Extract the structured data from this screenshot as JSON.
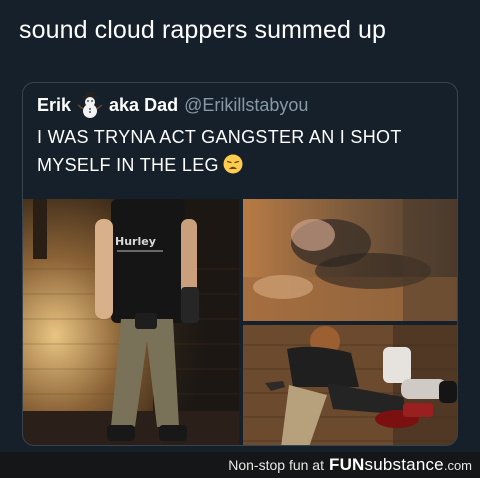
{
  "caption": "sound cloud rappers summed up",
  "tweet": {
    "author_name": "Erik",
    "author_suffix": "aka Dad",
    "author_handle": "@Erikillstabyou",
    "text": "I WAS TRYNA ACT GANGSTER AN I SHOT MYSELF IN THE LEG",
    "emoji": "weary-face-icon",
    "name_emoji": "snowman-icon"
  },
  "photos": {
    "left_shirt_text": "Hurley"
  },
  "footer": {
    "tagline": "Non-stop fun at",
    "brand_bold": "FUN",
    "brand_light": "substance",
    "domain": ".com"
  },
  "colors": {
    "background": "#15202b",
    "card_border": "#38444d",
    "handle": "#8899a6",
    "footer_bg": "#151617"
  }
}
